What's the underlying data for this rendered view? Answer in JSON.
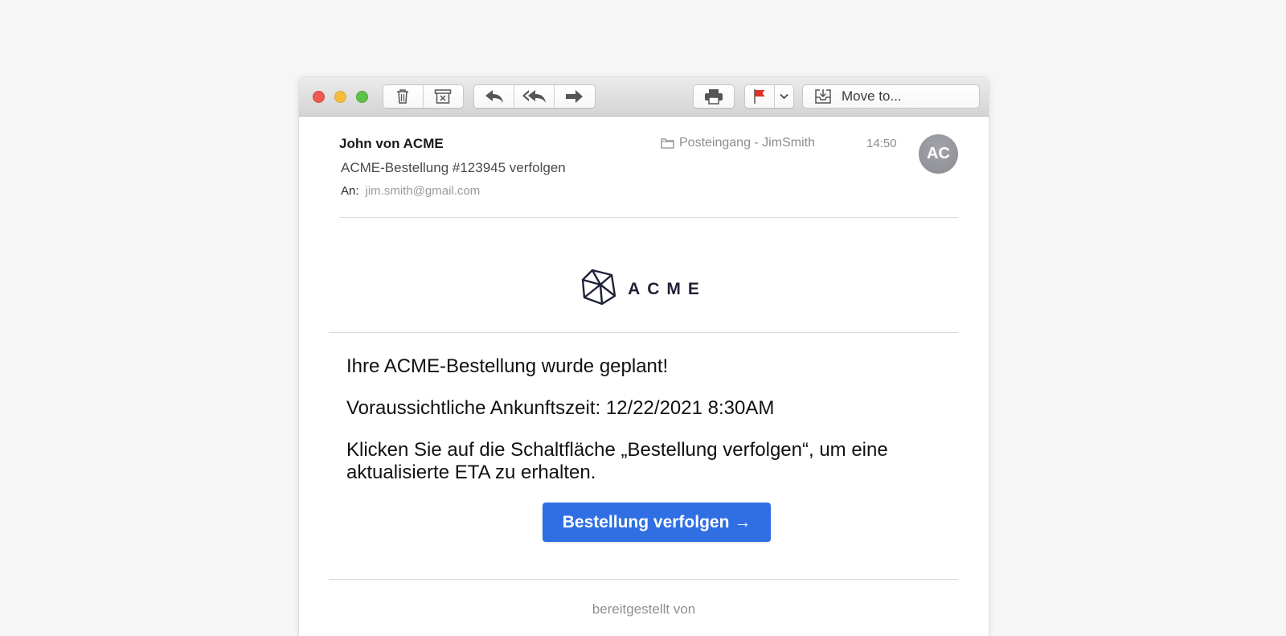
{
  "toolbar": {
    "move_label": "Move to..."
  },
  "message": {
    "sender": "John von ACME",
    "subject": "ACME-Bestellung #123945 verfolgen",
    "to_label": "An:",
    "to_address": "jim.smith@gmail.com",
    "mailbox": "Posteingang - JimSmith",
    "time": "14:50",
    "avatar_initials": "AC"
  },
  "email_body": {
    "logo_text": "ACME",
    "headline": "Ihre ACME-Bestellung wurde geplant!",
    "eta": "Voraussichtliche Ankunftszeit: 12/22/2021 8:30AM",
    "instruction": "Klicken Sie auf die Schaltfläche „Bestellung verfolgen“, um eine aktualisierte ETA zu erhalten.",
    "cta_label": "Bestellung verfolgen →",
    "footer": "bereitgestellt von"
  },
  "colors": {
    "cta_background": "#2f6fe3",
    "flag": "#e0312b",
    "logo": "#1f2137"
  },
  "icons": [
    "trash-icon",
    "archive-icon",
    "reply-icon",
    "reply-all-icon",
    "forward-icon",
    "print-icon",
    "flag-icon",
    "chevron-down-icon",
    "move-to-icon",
    "folder-icon",
    "acme-cube-icon"
  ]
}
